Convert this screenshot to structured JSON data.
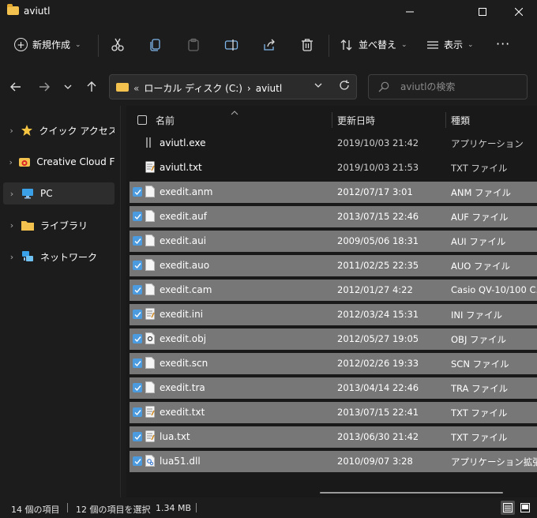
{
  "window": {
    "title": "aviutl"
  },
  "toolbar": {
    "new_label": "新規作成",
    "sort_label": "並べ替え",
    "view_label": "表示",
    "more_label": "···"
  },
  "address": {
    "prefix": "«",
    "drive": "ローカル ディスク (C:)",
    "separator": "›",
    "folder": "aviutl"
  },
  "search": {
    "placeholder": "aviutlの検索"
  },
  "sidebar": {
    "items": [
      {
        "label": "クイック アクセス",
        "icon": "star-icon"
      },
      {
        "label": "Creative Cloud File",
        "icon": "creative-cloud-icon"
      },
      {
        "label": "PC",
        "icon": "monitor-icon"
      },
      {
        "label": "ライブラリ",
        "icon": "folder-icon"
      },
      {
        "label": "ネットワーク",
        "icon": "network-icon"
      }
    ]
  },
  "columns": {
    "name": "名前",
    "date": "更新日時",
    "type": "種類"
  },
  "files": [
    {
      "name": "aviutl.exe",
      "date": "2019/10/03 21:42",
      "type": "アプリケーション",
      "selected": false,
      "icon": "exe-icon"
    },
    {
      "name": "aviutl.txt",
      "date": "2019/10/03 21:53",
      "type": "TXT ファイル",
      "selected": false,
      "icon": "text-file-icon"
    },
    {
      "name": "exedit.anm",
      "date": "2012/07/17 3:01",
      "type": "ANM ファイル",
      "selected": true,
      "icon": "blank-file-icon"
    },
    {
      "name": "exedit.auf",
      "date": "2013/07/15 22:46",
      "type": "AUF ファイル",
      "selected": true,
      "icon": "blank-file-icon"
    },
    {
      "name": "exedit.aui",
      "date": "2009/05/06 18:31",
      "type": "AUI ファイル",
      "selected": true,
      "icon": "blank-file-icon"
    },
    {
      "name": "exedit.auo",
      "date": "2011/02/25 22:35",
      "type": "AUO ファイル",
      "selected": true,
      "icon": "blank-file-icon"
    },
    {
      "name": "exedit.cam",
      "date": "2012/01/27 4:22",
      "type": "Casio QV-10/100 C...",
      "selected": true,
      "icon": "blank-file-icon"
    },
    {
      "name": "exedit.ini",
      "date": "2012/03/24 15:31",
      "type": "INI ファイル",
      "selected": true,
      "icon": "text-file-icon"
    },
    {
      "name": "exedit.obj",
      "date": "2012/05/27 19:05",
      "type": "OBJ ファイル",
      "selected": true,
      "icon": "obj-file-icon"
    },
    {
      "name": "exedit.scn",
      "date": "2012/02/26 19:33",
      "type": "SCN ファイル",
      "selected": true,
      "icon": "blank-file-icon"
    },
    {
      "name": "exedit.tra",
      "date": "2013/04/14 22:46",
      "type": "TRA ファイル",
      "selected": true,
      "icon": "blank-file-icon"
    },
    {
      "name": "exedit.txt",
      "date": "2013/07/15 22:41",
      "type": "TXT ファイル",
      "selected": true,
      "icon": "text-file-icon"
    },
    {
      "name": "lua.txt",
      "date": "2013/06/30 21:42",
      "type": "TXT ファイル",
      "selected": true,
      "icon": "text-file-icon"
    },
    {
      "name": "lua51.dll",
      "date": "2010/09/07 3:28",
      "type": "アプリケーション拡張",
      "selected": true,
      "icon": "dll-file-icon"
    }
  ],
  "status": {
    "item_count": "14 個の項目",
    "selection": "12 個の項目を選択",
    "size": "1.34 MB"
  },
  "colors": {
    "accent": "#4c9bde",
    "folder": "#f2c14e",
    "selected_row": "#777777",
    "background": "#191919"
  }
}
